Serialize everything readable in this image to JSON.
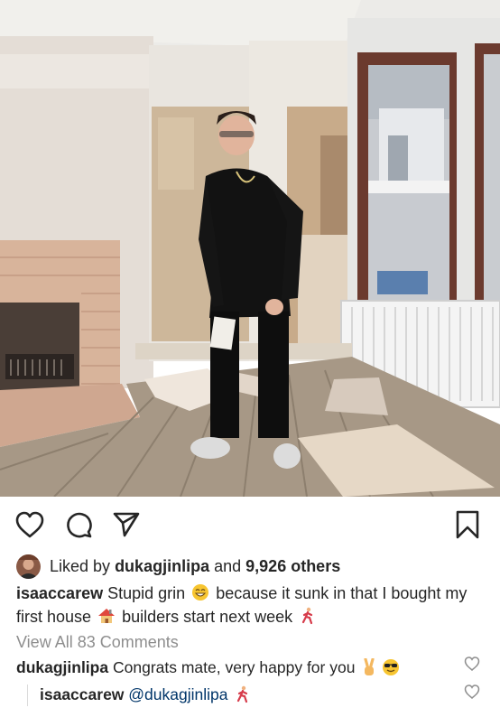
{
  "post": {
    "photo_alt": "",
    "icons": {
      "like": "heart-outline-icon",
      "comment": "speech-bubble-icon",
      "share": "paper-plane-icon",
      "save": "bookmark-icon"
    },
    "likes": {
      "prefix": "Liked by",
      "user": "dukagjinlipa",
      "connector": "and",
      "count": "9,926 others"
    },
    "caption": {
      "username": "isaaccarew",
      "text_1": "Stupid grin",
      "text_2": "because it sunk in that I bought my first house",
      "text_3": "builders start next week",
      "emojis": [
        "grinning-face-icon",
        "house-icon",
        "running-person-icon"
      ]
    },
    "view_all": "View All 83 Comments",
    "comments": [
      {
        "username": "dukagjinlipa",
        "text": "Congrats mate, very happy for you",
        "emojis": [
          "victory-hand-icon",
          "sunglasses-face-icon"
        ]
      },
      {
        "username": "isaaccarew",
        "text": "@dukagjinlipa",
        "emojis": [
          "running-person-icon"
        ]
      }
    ]
  },
  "colors": {
    "text": "#262626",
    "secondary": "#8e8e8e",
    "mention": "#003569"
  }
}
